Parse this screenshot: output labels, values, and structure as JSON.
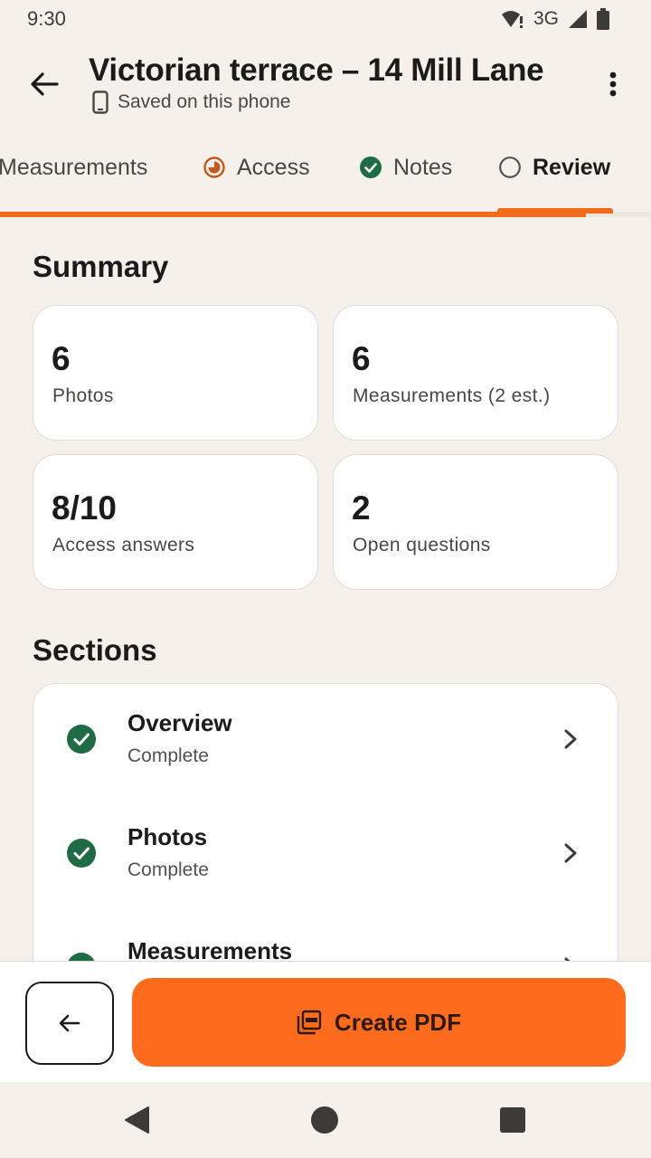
{
  "status_bar": {
    "time": "9:30",
    "network": "3G",
    "icons": [
      "wifi-alert-icon",
      "cellular-signal-icon",
      "battery-icon"
    ]
  },
  "app_bar": {
    "title": "Victorian terrace – 14 Mill Lane",
    "subtitle": "Saved on this phone",
    "icons": [
      "back-arrow-icon",
      "phone-icon",
      "more-vert-icon"
    ]
  },
  "tabs": [
    {
      "label": "Measurements",
      "state": "default"
    },
    {
      "label": "Access",
      "state": "partial",
      "icon": "half-circle-icon"
    },
    {
      "label": "Notes",
      "state": "complete",
      "icon": "check-circle-icon"
    },
    {
      "label": "Review",
      "state": "active",
      "icon": "empty-circle-icon"
    }
  ],
  "progress": {
    "value": 0.9
  },
  "summary": {
    "title": "Summary",
    "cards": [
      {
        "value": "6",
        "label": "Photos"
      },
      {
        "value": "6",
        "label": "Measurements (2 est.)"
      },
      {
        "value": "8/10",
        "label": "Access answers"
      },
      {
        "value": "2",
        "label": "Open questions"
      }
    ]
  },
  "sections": {
    "title": "Sections",
    "items": [
      {
        "name": "Overview",
        "status": "Complete"
      },
      {
        "name": "Photos",
        "status": "Complete"
      },
      {
        "name": "Measurements",
        "status": ""
      }
    ]
  },
  "bottom_bar": {
    "create_pdf_label": "Create PDF",
    "icons": [
      "arrow-left-icon",
      "pdf-icon"
    ]
  },
  "colors": {
    "accent": "#ff6b1c",
    "success": "#1e6b45",
    "background": "#f5f1ea"
  }
}
